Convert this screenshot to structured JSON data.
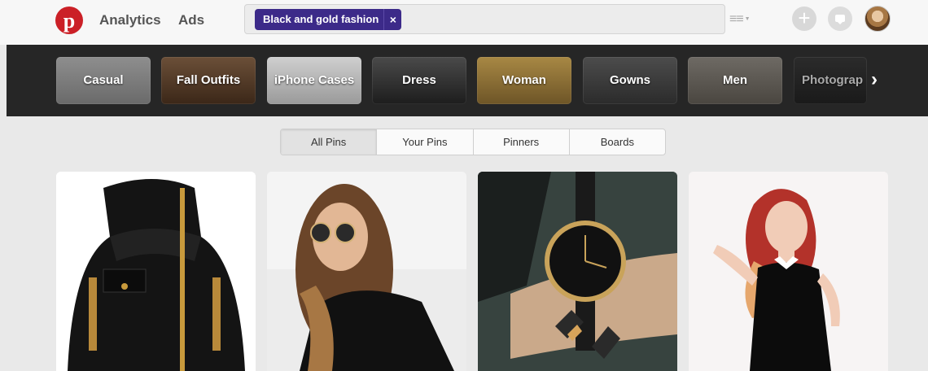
{
  "header": {
    "logo_letter": "p",
    "nav": [
      "Analytics",
      "Ads"
    ],
    "search": {
      "chip_label": "Black and gold fashion",
      "chip_remove": "×",
      "value": ""
    }
  },
  "guided_search": {
    "items": [
      {
        "label": "Casual"
      },
      {
        "label": "Fall Outfits"
      },
      {
        "label": "iPhone Cases"
      },
      {
        "label": "Dress"
      },
      {
        "label": "Woman"
      },
      {
        "label": "Gowns"
      },
      {
        "label": "Men"
      },
      {
        "label": "Photograp"
      }
    ],
    "next_glyph": "›"
  },
  "tabs": [
    {
      "label": "All Pins",
      "active": true
    },
    {
      "label": "Your Pins",
      "active": false
    },
    {
      "label": "Pinners",
      "active": false
    },
    {
      "label": "Boards",
      "active": false
    }
  ],
  "pins": [
    {
      "subject": "black-jacket"
    },
    {
      "subject": "woman-sunglasses"
    },
    {
      "subject": "watch-on-wrist"
    },
    {
      "subject": "woman-black-dress"
    }
  ],
  "colors": {
    "brand_red": "#cb2027",
    "chip_purple": "#3c2a89",
    "guided_bar": "#262626",
    "page_bg": "#e9e9e9"
  }
}
